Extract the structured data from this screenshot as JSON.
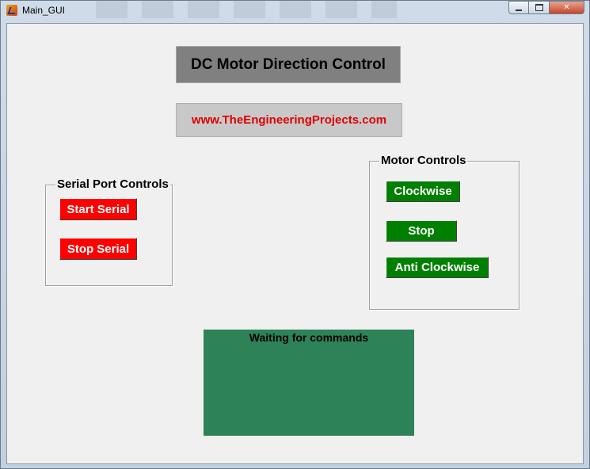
{
  "window": {
    "title": "Main_GUI"
  },
  "header": {
    "title": "DC Motor Direction Control",
    "url": "www.TheEngineeringProjects.com"
  },
  "serial_panel": {
    "title": "Serial Port Controls",
    "start_label": "Start Serial",
    "stop_label": "Stop Serial"
  },
  "motor_panel": {
    "title": "Motor Controls",
    "clockwise_label": "Clockwise",
    "stop_label": "Stop",
    "anticlockwise_label": "Anti Clockwise"
  },
  "status": {
    "text": "Waiting for commands"
  },
  "colors": {
    "title_bg": "#808080",
    "url_text": "#e00000",
    "serial_buttons": "#ff0000",
    "motor_buttons": "#008000",
    "status_bg": "#2e8258"
  },
  "icons": {
    "app": "matlab-icon",
    "minimize": "minimize-icon",
    "maximize": "maximize-icon",
    "close": "close-icon"
  }
}
